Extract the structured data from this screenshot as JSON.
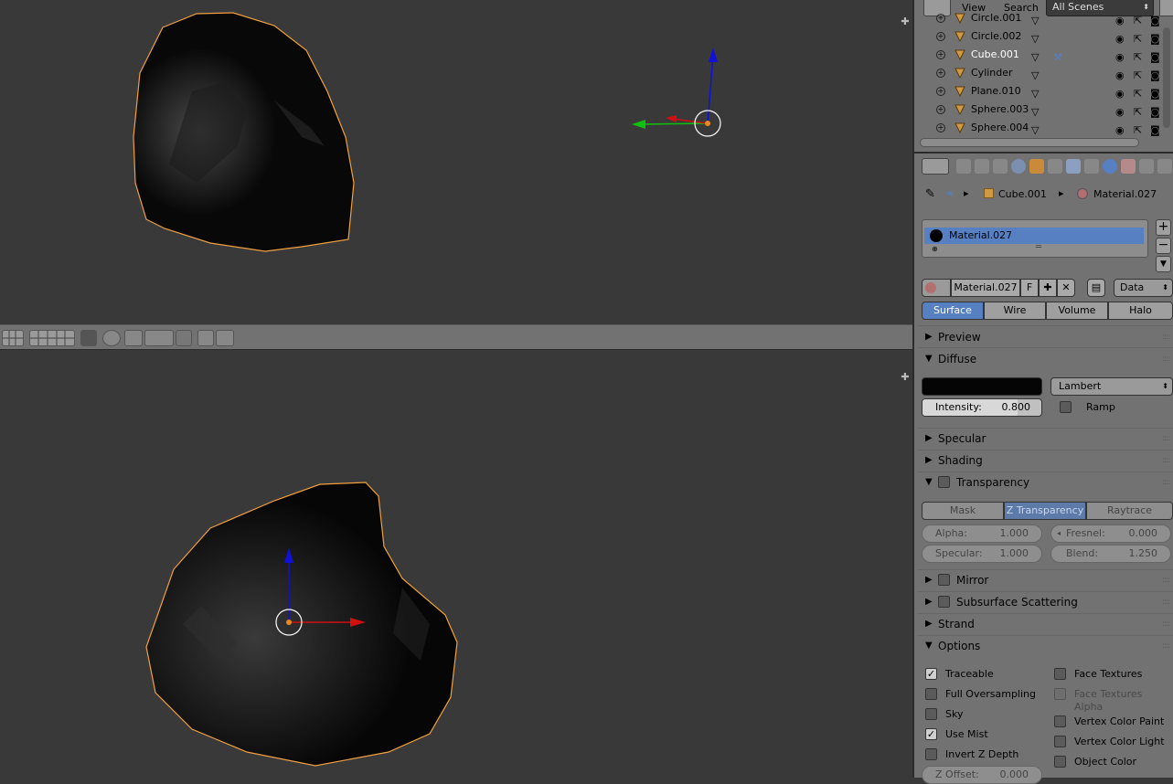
{
  "outliner": {
    "view_menu": "View",
    "search_menu": "Search",
    "scenes_dropdown": "All Scenes",
    "rows": [
      {
        "name": "Circle.001",
        "selected": false
      },
      {
        "name": "Circle.002",
        "selected": false
      },
      {
        "name": "Cube.001",
        "selected": true
      },
      {
        "name": "Cylinder",
        "selected": false
      },
      {
        "name": "Plane.010",
        "selected": false
      },
      {
        "name": "Sphere.003",
        "selected": false
      },
      {
        "name": "Sphere.004",
        "selected": false
      }
    ]
  },
  "properties": {
    "breadcrumb": {
      "object": "Cube.001",
      "material": "Material.027"
    },
    "slot_list": {
      "selected": "Material.027"
    },
    "datablock": {
      "name": "Material.027",
      "fake_user": "F",
      "link": "Data"
    },
    "type_tabs": {
      "surface": "Surface",
      "wire": "Wire",
      "volume": "Volume",
      "halo": "Halo"
    },
    "panels": {
      "preview": "Preview",
      "diffuse": "Diffuse",
      "specular": "Specular",
      "shading": "Shading",
      "transparency": "Transparency",
      "mirror": "Mirror",
      "sss": "Subsurface Scattering",
      "strand": "Strand",
      "options": "Options"
    },
    "diffuse": {
      "color": "#050505",
      "shader": "Lambert",
      "intensity_label": "Intensity:",
      "intensity_value": "0.800",
      "intensity_fraction": 0.8,
      "ramp_label": "Ramp"
    },
    "transparency": {
      "modes": {
        "mask": "Mask",
        "ztrans": "Z Transparency",
        "raytrace": "Raytrace"
      },
      "alpha_label": "Alpha:",
      "alpha_value": "1.000",
      "fresnel_label": "Fresnel:",
      "fresnel_value": "0.000",
      "specular_label": "Specular:",
      "specular_value": "1.000",
      "blend_label": "Blend:",
      "blend_value": "1.250"
    },
    "options": {
      "traceable": "Traceable",
      "full_oversampling": "Full Oversampling",
      "sky": "Sky",
      "use_mist": "Use Mist",
      "invert_z": "Invert Z Depth",
      "z_offset_label": "Z Offset:",
      "z_offset_value": "0.000",
      "face_textures": "Face Textures",
      "face_textures_alpha": "Face Textures Alpha",
      "vertex_color_paint": "Vertex Color Paint",
      "vertex_color_light": "Vertex Color Light",
      "object_color": "Object Color"
    }
  },
  "colors": {
    "viewport_bg": "#393939",
    "selection_outline": "#f0a040",
    "accent_blue": "#5680c2",
    "axis_x": "#d01010",
    "axis_y": "#10c010",
    "axis_z": "#1010d8"
  }
}
